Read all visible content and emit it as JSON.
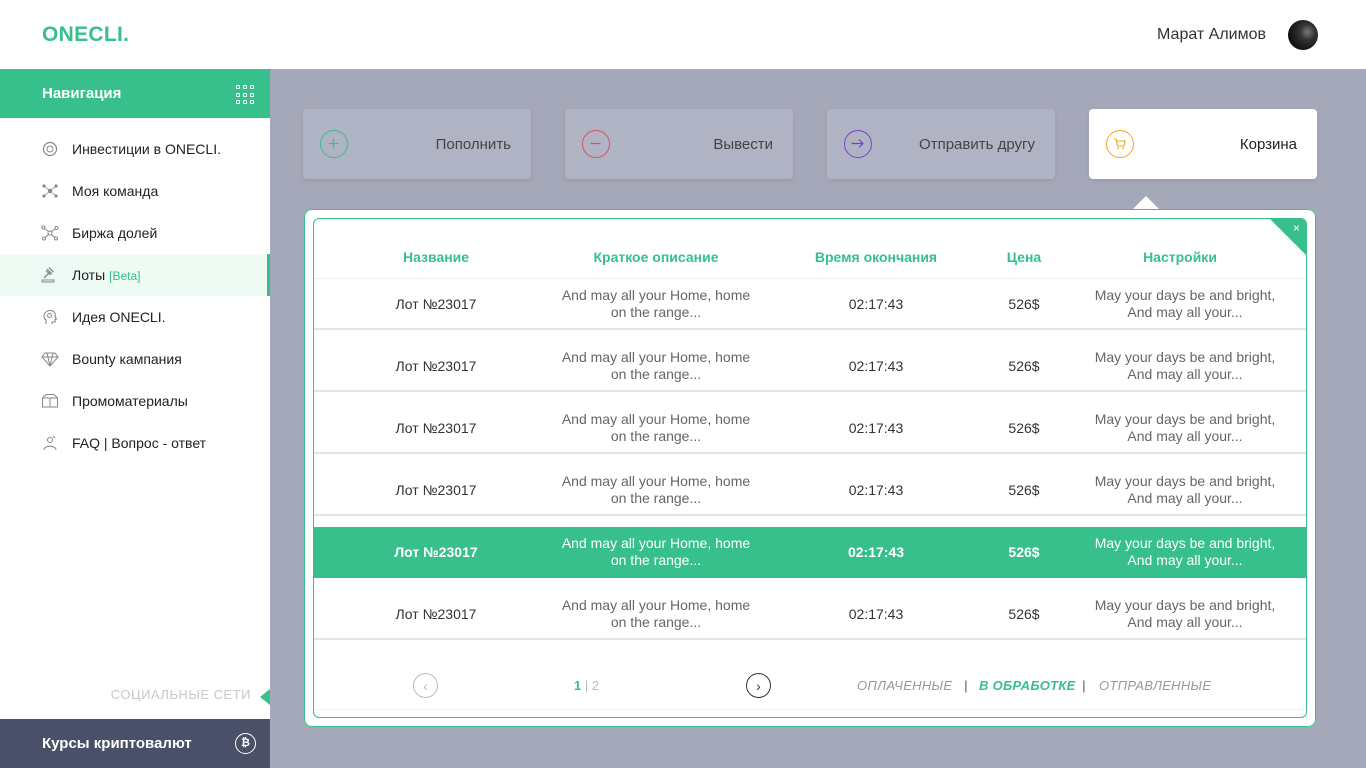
{
  "header": {
    "logo": "ONECLI.",
    "user_name": "Марат Алимов"
  },
  "sidebar": {
    "title": "Навигация",
    "items": [
      {
        "label": "Инвестиции в ONECLI.",
        "icon": "coin-hand-icon"
      },
      {
        "label": "Моя команда",
        "icon": "team-network-icon"
      },
      {
        "label": "Биржа долей",
        "icon": "nodes-icon"
      },
      {
        "label": "Лоты",
        "badge": "[Beta]",
        "icon": "auction-hammer-icon",
        "active": true
      },
      {
        "label": "Идея ONECLI.",
        "icon": "head-idea-icon"
      },
      {
        "label": "Bounty кампания",
        "icon": "diamond-icon"
      },
      {
        "label": "Промоматериалы",
        "icon": "box-icon"
      },
      {
        "label": "FAQ | Вопрос - ответ",
        "icon": "person-question-icon"
      }
    ],
    "social_label": "СОЦИАЛЬНЫЕ СЕТИ",
    "crypto_label": "Курсы криптовалют",
    "crypto_icon_glyph": "₿"
  },
  "actions": [
    {
      "label": "Пополнить",
      "glyph": "+",
      "color": "#37c08b"
    },
    {
      "label": "Вывести",
      "glyph": "−",
      "color": "#e0505a"
    },
    {
      "label": "Отправить другу",
      "glyph": "→",
      "color": "#7c3fc9"
    },
    {
      "label": "Корзина",
      "glyph": "🛒",
      "color": "#f2a623",
      "active": true
    }
  ],
  "table": {
    "close_glyph": "×",
    "columns": [
      "Название",
      "Краткое описание",
      "Время окончания",
      "Цена",
      "Настройки"
    ],
    "rows": [
      {
        "name": "Лот №23017",
        "desc": "And may all your Home, home on the range...",
        "time": "02:17:43",
        "price": "526$",
        "settings": "May your days be and bright, And may all your..."
      },
      {
        "name": "Лот №23017",
        "desc": "And may all your Home, home on the range...",
        "time": "02:17:43",
        "price": "526$",
        "settings": "May your days be and bright, And may all your..."
      },
      {
        "name": "Лот №23017",
        "desc": "And may all your Home, home on the range...",
        "time": "02:17:43",
        "price": "526$",
        "settings": "May your days be and bright, And may all your..."
      },
      {
        "name": "Лот №23017",
        "desc": "And may all your Home, home on the range...",
        "time": "02:17:43",
        "price": "526$",
        "settings": "May your days be and bright, And may all your..."
      },
      {
        "name": "Лот №23017",
        "desc": "And may all your Home, home on the range...",
        "time": "02:17:43",
        "price": "526$",
        "settings": "May your days be and bright, And may all your...",
        "selected": true
      },
      {
        "name": "Лот №23017",
        "desc": "And may all your Home, home on the range...",
        "time": "02:17:43",
        "price": "526$",
        "settings": "May your days be and bright, And may all your..."
      }
    ]
  },
  "pagination": {
    "current": "1",
    "separator": "|",
    "next_page": "2",
    "prev_glyph": "‹",
    "next_glyph": "›"
  },
  "status_filters": {
    "items": [
      "ОПЛАЧЕННЫЕ",
      "В ОБРАБОТКЕ",
      "ОТПРАВЛЕННЫЕ"
    ],
    "active_index": 1,
    "separator": "|"
  },
  "colors": {
    "accent": "#37c08b",
    "content_bg": "#a5a8b9",
    "sidebar_footer": "#4b5069"
  }
}
